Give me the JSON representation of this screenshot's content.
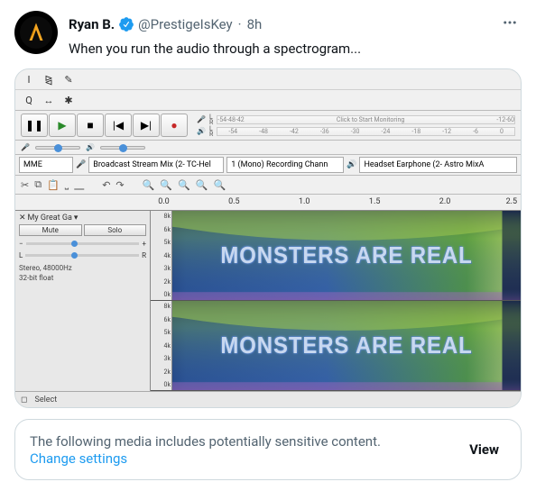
{
  "tweet": {
    "display_name": "Ryan B.",
    "handle": "@PrestigeIsKey",
    "time": "8h",
    "separator": "·",
    "text": "When you run the audio through a spectrogram...",
    "more_icon_label": "more-options"
  },
  "audacity": {
    "tools": {
      "ibeam": "I",
      "envelope": "⧎",
      "draw": "✎",
      "zoom": "Q",
      "timeshift": "↔",
      "multi": "✱"
    },
    "transport": {
      "pause": "❚❚",
      "play": "▶",
      "stop": "■",
      "skip_start": "|◀",
      "skip_end": "▶|",
      "record": "●"
    },
    "meter_ticks": [
      "-54",
      "-48",
      "-42",
      "-36",
      "-30",
      "-24",
      "-18",
      "-12",
      "-6",
      "0"
    ],
    "meter_click_text": "Click to Start Monitoring",
    "mic_icon": "🎤",
    "speaker_icon": "🔊",
    "lr_label": "L\nR",
    "device": {
      "host": "MME",
      "input": "Broadcast Stream Mix (2- TC-Hel",
      "channels": "1 (Mono) Recording Chann",
      "output": "Headset Earphone (2- Astro MixA"
    },
    "edit_tools": {
      "cut": "✂",
      "copy": "⧉",
      "paste": "📋",
      "trim": "⎵",
      "silence": "⎽",
      "undo": "↶",
      "redo": "↷",
      "zoom_in": "🔍",
      "zoom_out": "🔍",
      "zoom_sel": "🔍",
      "zoom_fit": "🔍",
      "zoom_toggle": "🔍"
    },
    "timeline": [
      "0.0",
      "0.5",
      "1.0",
      "1.5",
      "2.0",
      "2.5"
    ],
    "track": {
      "close": "✕",
      "name": "My Great Ga",
      "menu": "▾",
      "mute": "Mute",
      "solo": "Solo",
      "gain_minus": "−",
      "gain_plus": "+",
      "pan_l": "L",
      "pan_r": "R",
      "info1": "Stereo, 48000Hz",
      "info2": "32-bit float",
      "freq_labels": [
        "8k",
        "6k",
        "5k",
        "4k",
        "3k",
        "2k",
        "0k"
      ]
    },
    "spectro_text": "MONSTERS ARE REAL",
    "status": {
      "snap": "◻",
      "select": "Select"
    }
  },
  "warning": {
    "message": "The following media includes potentially sensitive content.",
    "link": "Change settings",
    "view": "View"
  }
}
